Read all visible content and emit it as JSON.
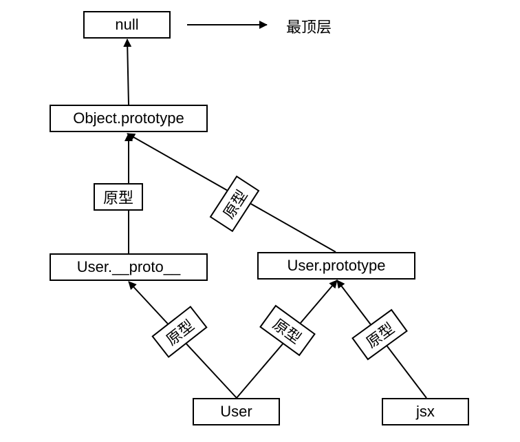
{
  "nodes": {
    "null": "null",
    "object_prototype": "Object.prototype",
    "user_proto": "User.__proto__",
    "user_prototype": "User.prototype",
    "user": "User",
    "jsx": "jsx"
  },
  "top_label": "最顶层",
  "edge_label": "原型"
}
